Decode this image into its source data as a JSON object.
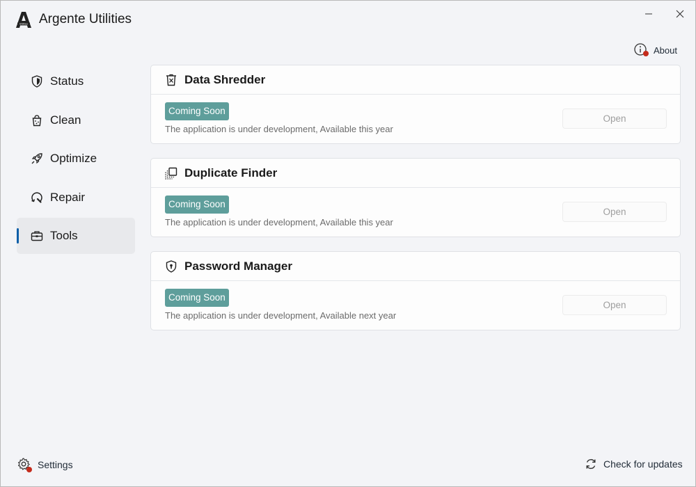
{
  "app": {
    "title": "Argente Utilities",
    "logo_text": "Utilities"
  },
  "window": {
    "minimize_icon": "minimize-icon",
    "close_icon": "close-icon"
  },
  "header": {
    "about_label": "About",
    "about_icon": "info-icon"
  },
  "sidebar": {
    "items": [
      {
        "id": "status",
        "label": "Status",
        "icon": "shield-icon",
        "active": false
      },
      {
        "id": "clean",
        "label": "Clean",
        "icon": "trash-bin-icon",
        "active": false
      },
      {
        "id": "optimize",
        "label": "Optimize",
        "icon": "rocket-icon",
        "active": false
      },
      {
        "id": "repair",
        "label": "Repair",
        "icon": "wrench-icon",
        "active": false
      },
      {
        "id": "tools",
        "label": "Tools",
        "icon": "toolbox-icon",
        "active": true
      }
    ]
  },
  "tools": [
    {
      "title": "Data Shredder",
      "icon": "shredder-icon",
      "badge": "Coming Soon",
      "description": "The application is under development, Available this year",
      "button": "Open"
    },
    {
      "title": "Duplicate Finder",
      "icon": "duplicate-icon",
      "badge": "Coming Soon",
      "description": "The application is under development, Available this year",
      "button": "Open"
    },
    {
      "title": "Password Manager",
      "icon": "password-shield-icon",
      "badge": "Coming Soon",
      "description": "The application is under development, Available next year",
      "button": "Open"
    }
  ],
  "footer": {
    "settings_label": "Settings",
    "settings_icon": "gear-icon",
    "updates_label": "Check for updates",
    "updates_icon": "refresh-icon"
  },
  "colors": {
    "accent": "#0c5fa8",
    "badge": "#5e9e9b",
    "notification_dot": "#c42b1c"
  }
}
